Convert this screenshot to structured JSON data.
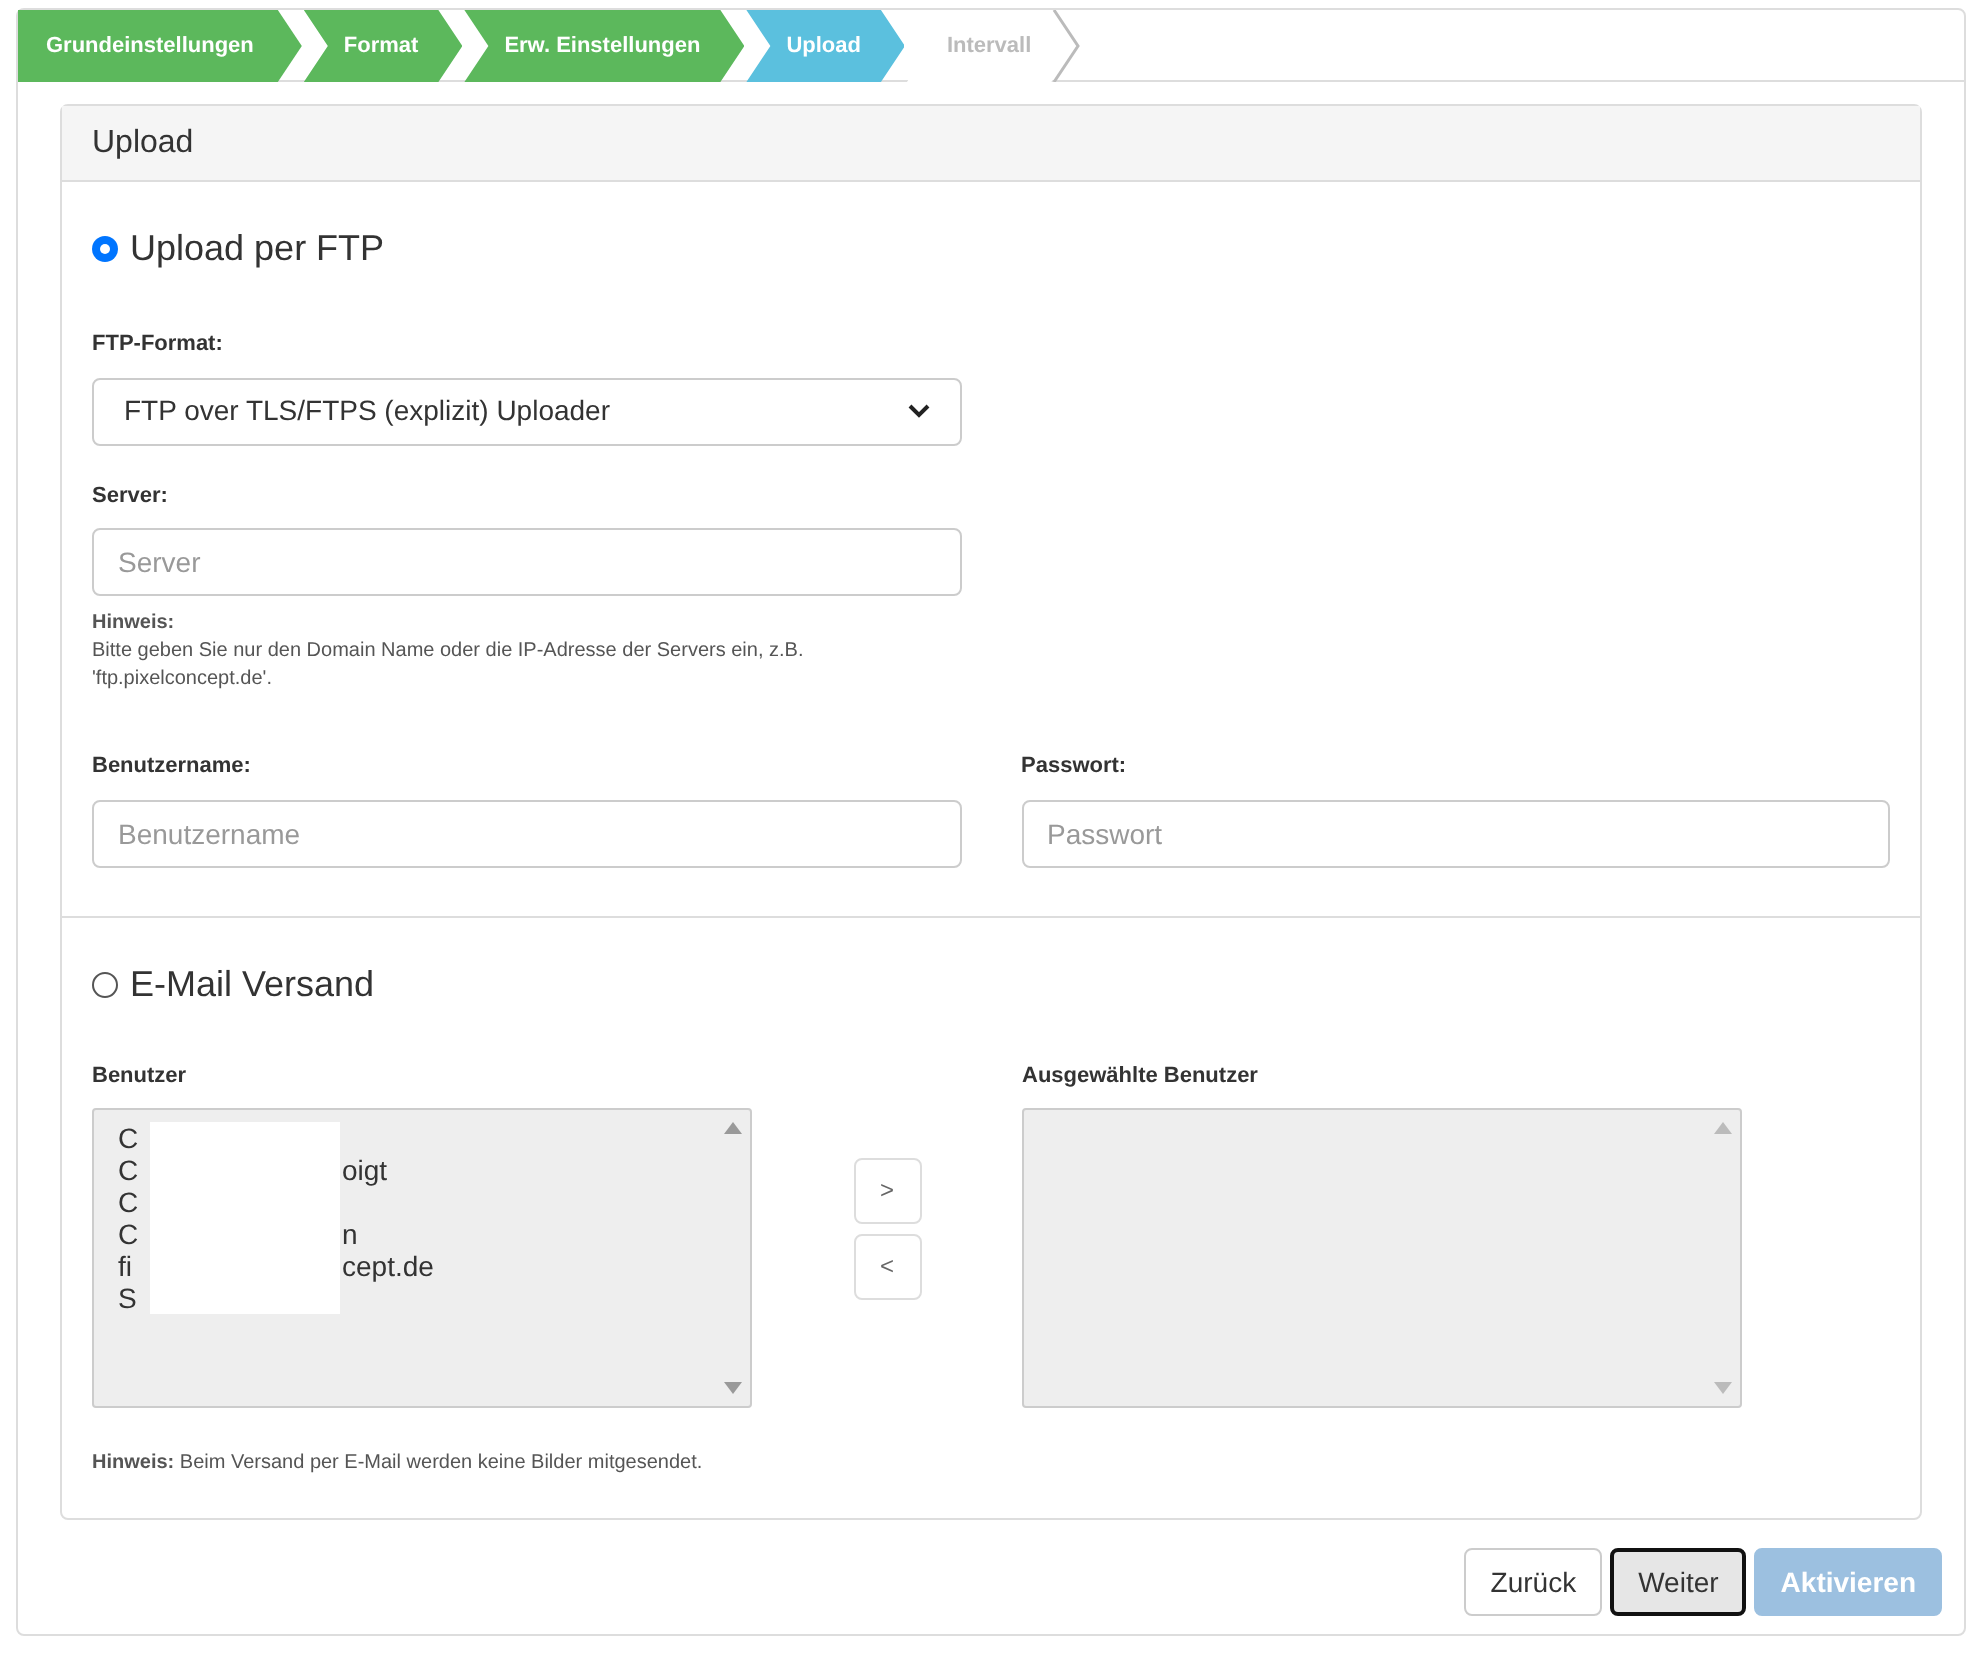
{
  "steps": [
    {
      "label": "Grundeinstellungen",
      "completed": true,
      "selected": false
    },
    {
      "label": "Format",
      "completed": true,
      "selected": false
    },
    {
      "label": "Erw. Einstellungen",
      "completed": true,
      "selected": false
    },
    {
      "label": "Upload",
      "completed": false,
      "selected": true
    },
    {
      "label": "Intervall",
      "completed": false,
      "selected": false
    }
  ],
  "panel": {
    "title": "Upload"
  },
  "ftp": {
    "label": "Upload per FTP",
    "selected": true,
    "format_label": "FTP-Format:",
    "format_value": "FTP over TLS/FTPS (explizit) Uploader",
    "server_label": "Server:",
    "server_placeholder": "Server",
    "hint_title": "Hinweis:",
    "hint_text": "Bitte geben Sie nur den Domain Name oder die IP-Adresse der Servers ein, z.B. 'ftp.pixelconcept.de'.",
    "user_label": "Benutzername:",
    "user_placeholder": "Benutzername",
    "password_label": "Passwort:",
    "password_placeholder": "Passwort"
  },
  "email": {
    "label": "E-Mail Versand",
    "selected": false,
    "users_label": "Benutzer",
    "users": [
      {
        "start": "C"
      },
      {
        "start": "C",
        "end": "oigt"
      },
      {
        "start": "C"
      },
      {
        "start": "C",
        "end": "n"
      },
      {
        "start": "fi",
        "end": "cept.de"
      },
      {
        "start": "S"
      }
    ],
    "add_button": ">",
    "remove_button": "<",
    "selected_label": "Ausgewählte Benutzer",
    "hint": "**Hinweis:** Beim Versand per E-Mail werden keine Bilder mitgesendet."
  },
  "buttons": [
    {
      "label": "Zurück",
      "kind": "default"
    },
    {
      "label": "Weiter",
      "kind": "focused"
    },
    {
      "label": "Aktivieren",
      "kind": "disabled_primary"
    }
  ]
}
